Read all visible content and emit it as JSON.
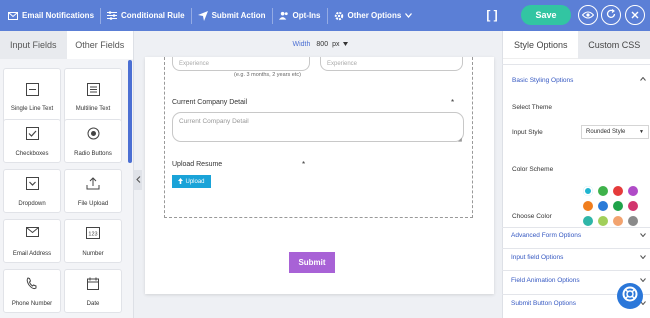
{
  "toolbar": {
    "email_notifications": "Email Notifications",
    "conditional_rule": "Conditional Rule",
    "submit_action": "Submit Action",
    "opt_ins": "Opt-Ins",
    "other_options": "Other Options",
    "brackets": "[ ]",
    "save": "Save",
    "accent": "#5b7fd6",
    "save_color": "#32c5a2"
  },
  "left_panel": {
    "tabs": [
      "Input Fields",
      "Other Fields"
    ],
    "fields": [
      {
        "label": "Single Line Text",
        "icon": "single-line-text-icon"
      },
      {
        "label": "Multiline Text",
        "icon": "multiline-text-icon"
      },
      {
        "label": "Checkboxes",
        "icon": "checkbox-icon"
      },
      {
        "label": "Radio Buttons",
        "icon": "radio-icon"
      },
      {
        "label": "Dropdown",
        "icon": "dropdown-icon"
      },
      {
        "label": "File Upload",
        "icon": "upload-icon"
      },
      {
        "label": "Email Address",
        "icon": "email-icon"
      },
      {
        "label": "Number",
        "icon": "number-icon"
      },
      {
        "label": "Phone Number",
        "icon": "phone-icon"
      },
      {
        "label": "Date",
        "icon": "calendar-icon"
      }
    ]
  },
  "canvas": {
    "width_label": "Width",
    "width_value": "800",
    "width_unit": "px",
    "experience_placeholder_1": "Experience",
    "experience_placeholder_2": "Experience",
    "experience_hint": "(e.g. 3 months, 2 years etc)",
    "company_label": "Current Company Detail",
    "company_placeholder": "Current Company Detail",
    "required_mark": "*",
    "resume_label": "Upload Resume",
    "upload_button": "Upload",
    "submit_button": "Submit",
    "submit_color": "#a862d6"
  },
  "right_panel": {
    "tabs": [
      "Style Options",
      "Custom CSS"
    ],
    "basic_styling": "Basic Styling Options",
    "select_theme": "Select Theme",
    "input_style_label": "Input Style",
    "input_style_value": "Rounded Style",
    "color_scheme": "Color Scheme",
    "choose_color": "Choose Color",
    "sections": [
      "Advanced Form Options",
      "Input field Options",
      "Field Animation Options",
      "Submit Button Options"
    ],
    "swatches": [
      "#1fb5d0",
      "#3fb24b",
      "#e53b3b",
      "#b04bc7",
      "#f07e1e",
      "#2a7bd8",
      "#1fa34a",
      "#d2366e",
      "#2fb6a8",
      "#a1cf5a",
      "#f2a36f",
      "#8a8a8a"
    ]
  }
}
